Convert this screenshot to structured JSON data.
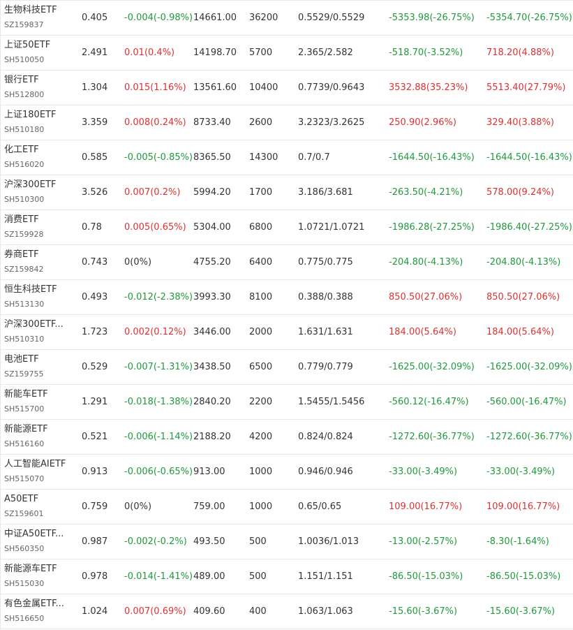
{
  "colors": {
    "up": "#e03030",
    "down": "#1f9a3c",
    "flat": "#333333",
    "border": "#e8e8e8"
  },
  "rows": [
    {
      "name": "生物科技ETF",
      "code": "SZ159837",
      "price": "0.405",
      "change": "-0.004(-0.98%)",
      "change_dir": "down",
      "amount": "14661.00",
      "shares": "36200",
      "cost": "0.5529/0.5529",
      "profit": "-5353.98(-26.75%)",
      "profit_dir": "down",
      "total": "-5354.70(-26.75%)",
      "total_dir": "down"
    },
    {
      "name": "上证50ETF",
      "code": "SH510050",
      "price": "2.491",
      "change": "0.01(0.4%)",
      "change_dir": "up",
      "amount": "14198.70",
      "shares": "5700",
      "cost": "2.365/2.582",
      "profit": "-518.70(-3.52%)",
      "profit_dir": "down",
      "total": "718.20(4.88%)",
      "total_dir": "up"
    },
    {
      "name": "银行ETF",
      "code": "SH512800",
      "price": "1.304",
      "change": "0.015(1.16%)",
      "change_dir": "up",
      "amount": "13561.60",
      "shares": "10400",
      "cost": "0.7739/0.9643",
      "profit": "3532.88(35.23%)",
      "profit_dir": "up",
      "total": "5513.40(27.79%)",
      "total_dir": "up"
    },
    {
      "name": "上证180ETF",
      "code": "SH510180",
      "price": "3.359",
      "change": "0.008(0.24%)",
      "change_dir": "up",
      "amount": "8733.40",
      "shares": "2600",
      "cost": "3.2323/3.2625",
      "profit": "250.90(2.96%)",
      "profit_dir": "up",
      "total": "329.40(3.88%)",
      "total_dir": "up"
    },
    {
      "name": "化工ETF",
      "code": "SH516020",
      "price": "0.585",
      "change": "-0.005(-0.85%)",
      "change_dir": "down",
      "amount": "8365.50",
      "shares": "14300",
      "cost": "0.7/0.7",
      "profit": "-1644.50(-16.43%)",
      "profit_dir": "down",
      "total": "-1644.50(-16.43%)",
      "total_dir": "down"
    },
    {
      "name": "沪深300ETF",
      "code": "SH510300",
      "price": "3.526",
      "change": "0.007(0.2%)",
      "change_dir": "up",
      "amount": "5994.20",
      "shares": "1700",
      "cost": "3.186/3.681",
      "profit": "-263.50(-4.21%)",
      "profit_dir": "down",
      "total": "578.00(9.24%)",
      "total_dir": "up"
    },
    {
      "name": "消费ETF",
      "code": "SZ159928",
      "price": "0.78",
      "change": "0.005(0.65%)",
      "change_dir": "up",
      "amount": "5304.00",
      "shares": "6800",
      "cost": "1.0721/1.0721",
      "profit": "-1986.28(-27.25%)",
      "profit_dir": "down",
      "total": "-1986.40(-27.25%)",
      "total_dir": "down"
    },
    {
      "name": "券商ETF",
      "code": "SZ159842",
      "price": "0.743",
      "change": "0(0%)",
      "change_dir": "flat",
      "amount": "4755.20",
      "shares": "6400",
      "cost": "0.775/0.775",
      "profit": "-204.80(-4.13%)",
      "profit_dir": "down",
      "total": "-204.80(-4.13%)",
      "total_dir": "down"
    },
    {
      "name": "恒生科技ETF",
      "code": "SH513130",
      "price": "0.493",
      "change": "-0.012(-2.38%)",
      "change_dir": "down",
      "amount": "3993.30",
      "shares": "8100",
      "cost": "0.388/0.388",
      "profit": "850.50(27.06%)",
      "profit_dir": "up",
      "total": "850.50(27.06%)",
      "total_dir": "up"
    },
    {
      "name": "沪深300ETF...",
      "code": "SH510310",
      "price": "1.723",
      "change": "0.002(0.12%)",
      "change_dir": "up",
      "amount": "3446.00",
      "shares": "2000",
      "cost": "1.631/1.631",
      "profit": "184.00(5.64%)",
      "profit_dir": "up",
      "total": "184.00(5.64%)",
      "total_dir": "up"
    },
    {
      "name": "电池ETF",
      "code": "SZ159755",
      "price": "0.529",
      "change": "-0.007(-1.31%)",
      "change_dir": "down",
      "amount": "3438.50",
      "shares": "6500",
      "cost": "0.779/0.779",
      "profit": "-1625.00(-32.09%)",
      "profit_dir": "down",
      "total": "-1625.00(-32.09%)",
      "total_dir": "down"
    },
    {
      "name": "新能车ETF",
      "code": "SH515700",
      "price": "1.291",
      "change": "-0.018(-1.38%)",
      "change_dir": "down",
      "amount": "2840.20",
      "shares": "2200",
      "cost": "1.5455/1.5456",
      "profit": "-560.12(-16.47%)",
      "profit_dir": "down",
      "total": "-560.00(-16.47%)",
      "total_dir": "down"
    },
    {
      "name": "新能源ETF",
      "code": "SH516160",
      "price": "0.521",
      "change": "-0.006(-1.14%)",
      "change_dir": "down",
      "amount": "2188.20",
      "shares": "4200",
      "cost": "0.824/0.824",
      "profit": "-1272.60(-36.77%)",
      "profit_dir": "down",
      "total": "-1272.60(-36.77%)",
      "total_dir": "down"
    },
    {
      "name": "人工智能AIETF",
      "code": "SH515070",
      "price": "0.913",
      "change": "-0.006(-0.65%)",
      "change_dir": "down",
      "amount": "913.00",
      "shares": "1000",
      "cost": "0.946/0.946",
      "profit": "-33.00(-3.49%)",
      "profit_dir": "down",
      "total": "-33.00(-3.49%)",
      "total_dir": "down"
    },
    {
      "name": "A50ETF",
      "code": "SZ159601",
      "price": "0.759",
      "change": "0(0%)",
      "change_dir": "flat",
      "amount": "759.00",
      "shares": "1000",
      "cost": "0.65/0.65",
      "profit": "109.00(16.77%)",
      "profit_dir": "up",
      "total": "109.00(16.77%)",
      "total_dir": "up"
    },
    {
      "name": "中证A50ETF...",
      "code": "SH560350",
      "price": "0.987",
      "change": "-0.002(-0.2%)",
      "change_dir": "down",
      "amount": "493.50",
      "shares": "500",
      "cost": "1.0036/1.013",
      "profit": "-13.00(-2.57%)",
      "profit_dir": "down",
      "total": "-8.30(-1.64%)",
      "total_dir": "down"
    },
    {
      "name": "新能源车ETF",
      "code": "SH515030",
      "price": "0.978",
      "change": "-0.014(-1.41%)",
      "change_dir": "down",
      "amount": "489.00",
      "shares": "500",
      "cost": "1.151/1.151",
      "profit": "-86.50(-15.03%)",
      "profit_dir": "down",
      "total": "-86.50(-15.03%)",
      "total_dir": "down"
    },
    {
      "name": "有色金属ETF...",
      "code": "SH516650",
      "price": "1.024",
      "change": "0.007(0.69%)",
      "change_dir": "up",
      "amount": "409.60",
      "shares": "400",
      "cost": "1.063/1.063",
      "profit": "-15.60(-3.67%)",
      "profit_dir": "down",
      "total": "-15.60(-3.67%)",
      "total_dir": "down"
    }
  ]
}
